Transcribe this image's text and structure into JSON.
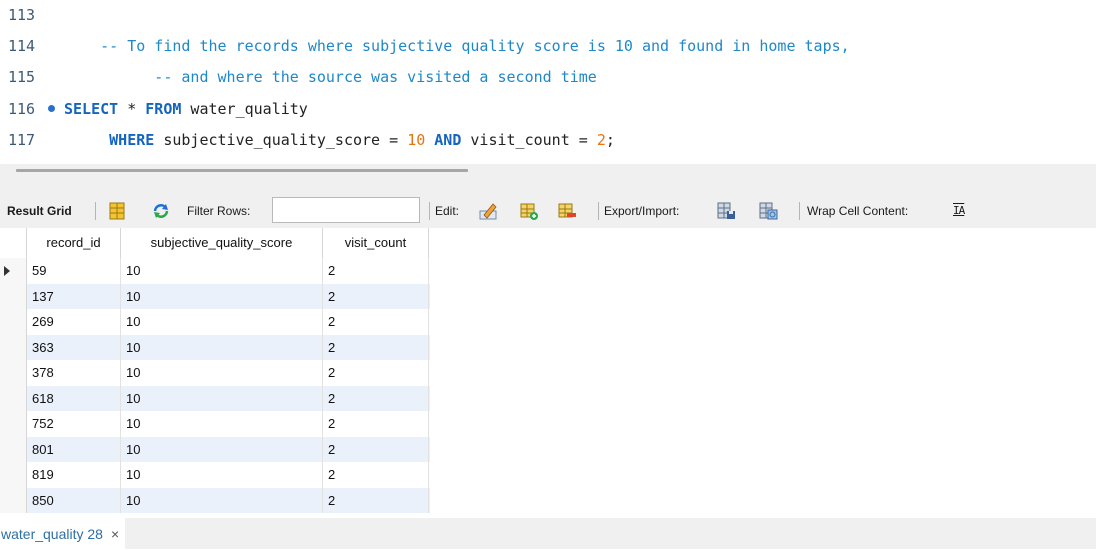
{
  "editor": {
    "lines": [
      {
        "num": "113",
        "code": []
      },
      {
        "num": "114",
        "code": [
          {
            "t": "    -- To find the records where subjective quality score is 10 and found in home taps,",
            "c": "cmt"
          }
        ]
      },
      {
        "num": "115",
        "code": [
          {
            "t": "          -- and where the source was visited a second time",
            "c": "cmt"
          }
        ]
      },
      {
        "num": "116",
        "breakpoint": true,
        "code": [
          {
            "t": "SELECT",
            "c": "kw"
          },
          {
            "t": " * ",
            "c": "plain"
          },
          {
            "t": "FROM",
            "c": "kw"
          },
          {
            "t": " water_quality",
            "c": "plain"
          }
        ]
      },
      {
        "num": "117",
        "code": [
          {
            "t": "     WHERE",
            "c": "kw"
          },
          {
            "t": " subjective_quality_score = ",
            "c": "plain"
          },
          {
            "t": "10",
            "c": "num"
          },
          {
            "t": " ",
            "c": "plain"
          },
          {
            "t": "AND",
            "c": "kw"
          },
          {
            "t": " visit_count = ",
            "c": "plain"
          },
          {
            "t": "2",
            "c": "num"
          },
          {
            "t": ";",
            "c": "plain"
          }
        ]
      }
    ]
  },
  "toolbar": {
    "result_grid": "Result Grid",
    "filter_rows": "Filter Rows:",
    "filter_value": "",
    "edit": "Edit:",
    "export_import": "Export/Import:",
    "wrap_cell": "Wrap Cell Content:",
    "wrap_icon_text": "IA"
  },
  "grid": {
    "columns": [
      "record_id",
      "subjective_quality_score",
      "visit_count"
    ],
    "rows": [
      [
        "59",
        "10",
        "2"
      ],
      [
        "137",
        "10",
        "2"
      ],
      [
        "269",
        "10",
        "2"
      ],
      [
        "363",
        "10",
        "2"
      ],
      [
        "378",
        "10",
        "2"
      ],
      [
        "618",
        "10",
        "2"
      ],
      [
        "752",
        "10",
        "2"
      ],
      [
        "801",
        "10",
        "2"
      ],
      [
        "819",
        "10",
        "2"
      ],
      [
        "850",
        "10",
        "2"
      ]
    ]
  },
  "tabs": [
    {
      "label": "water_quality 28",
      "close": "×"
    }
  ],
  "colors": {
    "comment": "#1e88c8",
    "keyword": "#1565c0",
    "number": "#e8740f",
    "row_alt": "#eaf1fb"
  }
}
